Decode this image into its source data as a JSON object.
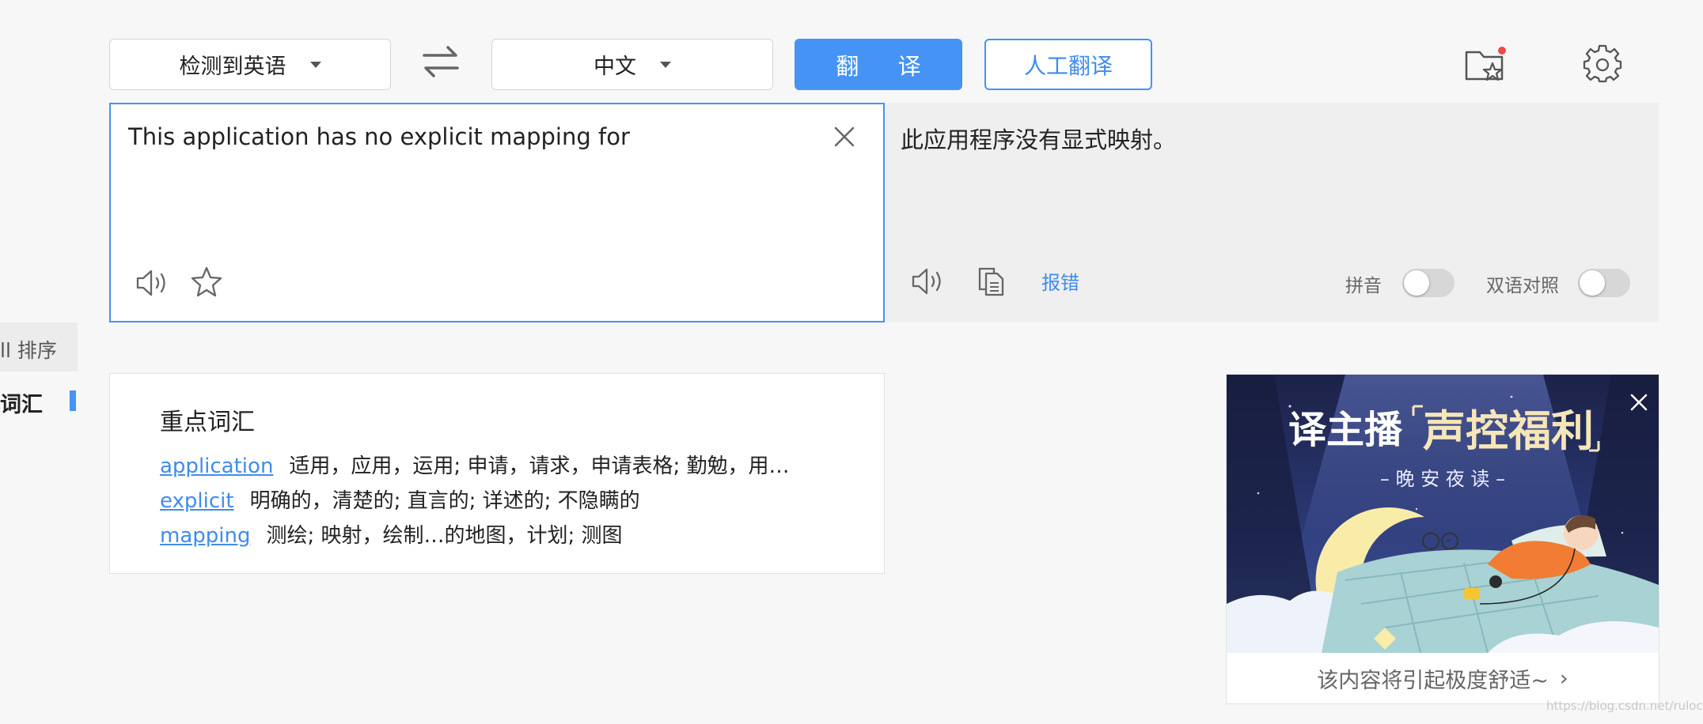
{
  "toolbar": {
    "source_lang": "检测到英语",
    "target_lang": "中文",
    "translate_label": "翻 译",
    "human_translate_label": "人工翻译",
    "accent_color": "#4593f5"
  },
  "source": {
    "text": "This application has no explicit mapping for"
  },
  "target": {
    "text": "此应用程序没有显式映射。",
    "report_label": "报错",
    "pinyin_label": "拼音",
    "pinyin_on": false,
    "bilingual_label": "双语对照",
    "bilingual_on": false
  },
  "sidebar": {
    "sort_label": "ll 排序",
    "vocab_label": "词汇"
  },
  "vocab": {
    "title": "重点词汇",
    "items": [
      {
        "word": "application",
        "meaning": "适用，应用，运用; 申请，请求，申请表格; 勤勉，用…"
      },
      {
        "word": "explicit",
        "meaning": "明确的，清楚的; 直言的; 详述的; 不隐瞒的"
      },
      {
        "word": "mapping",
        "meaning": "测绘; 映射，绘制…的地图，计划; 测图"
      }
    ]
  },
  "ad": {
    "headline_left": "译主播",
    "headline_right": "声控福利",
    "subline": "– 晚 安 夜 读 –",
    "footer_text": "该内容将引起极度舒适~",
    "chevron": "›"
  },
  "watermark": "https://blog.csdn.net/rulocle"
}
